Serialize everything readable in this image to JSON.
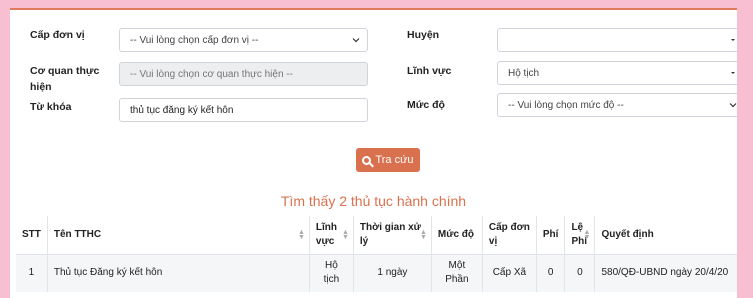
{
  "form": {
    "cap_don_vi_label": "Cấp đơn vị",
    "cap_don_vi_value": "-- Vui lòng chọn cấp đơn vị --",
    "huyen_label": "Huyện",
    "huyen_value": "",
    "co_quan_label_1": "Cơ quan thực",
    "co_quan_label_2": "hiện",
    "co_quan_value": "-- Vui lòng chọn cơ quan thực hiện --",
    "linh_vuc_label": "Lĩnh vực",
    "linh_vuc_value": "Hộ tịch",
    "tu_khoa_label": "Từ khóa",
    "tu_khoa_value": "thủ tục đăng ký kết hôn",
    "muc_do_label": "Mức độ",
    "muc_do_value": "-- Vui lòng chọn mức độ --",
    "search_button": "Tra cứu"
  },
  "result_text": "Tìm thấy 2 thủ tục hành chính",
  "table": {
    "headers": {
      "stt": "STT",
      "ten": "Tên TTHC",
      "linh_vuc_1": "Lĩnh",
      "linh_vuc_2": "vực",
      "thoi_gian": "Thời gian xử lý",
      "muc_do": "Mức độ",
      "cap_1": "Cấp đơn",
      "cap_2": "vị",
      "phi": "Phí",
      "le_phi_1": "Lệ",
      "le_phi_2": "Phí",
      "quyet_dinh": "Quyết định"
    },
    "rows": [
      {
        "stt": "1",
        "ten": "Thủ tục Đăng ký kết hôn",
        "linh_vuc": "Hộ tịch",
        "thoi_gian": "1 ngày",
        "muc_do_1": "Một",
        "muc_do_2": "Phần",
        "cap": "Cấp Xã",
        "phi": "0",
        "le_phi": "0",
        "quyet_dinh": "580/QĐ-UBND ngày 20/4/20"
      }
    ]
  },
  "colors": {
    "accent": "#d9714e",
    "background": "#f8bfd2"
  }
}
